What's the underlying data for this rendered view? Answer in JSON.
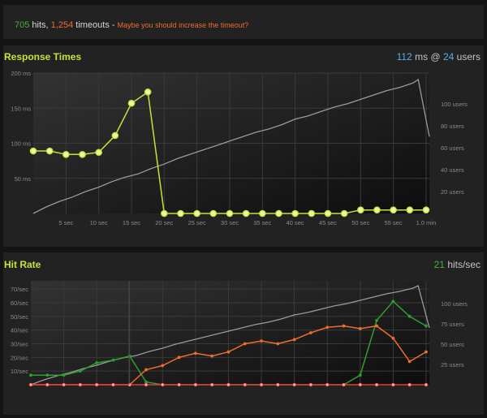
{
  "summary": {
    "hits": "705",
    "hits_label": "hits,",
    "timeouts": "1,254",
    "timeouts_label": "timeouts -",
    "message": "Maybe you should increase the timeout?"
  },
  "colors": {
    "response": "#c8e03a",
    "users": "#9a9a9a",
    "hits": "#2e9e2e",
    "failures": "#ee6d2c",
    "timeouts": "#e23a3a",
    "stat_blue": "#57aee8"
  },
  "chart_data": [
    {
      "type": "line",
      "title": "Response Times",
      "stat": {
        "value": "112",
        "unit": "ms",
        "at": "@",
        "users": "24",
        "users_unit": "users"
      },
      "x": {
        "ticks": [
          5,
          10,
          15,
          20,
          25,
          30,
          35,
          40,
          45,
          50,
          55,
          60
        ],
        "tick_labels": [
          "5 sec",
          "10 sec",
          "15 sec",
          "20 sec",
          "25 sec",
          "30 sec",
          "35 sec",
          "40 sec",
          "45 sec",
          "50 sec",
          "55 sec",
          "1.0 min"
        ],
        "range": [
          0,
          60.5
        ]
      },
      "y_left": {
        "ticks": [
          50,
          100,
          150,
          200
        ],
        "tick_labels": [
          "50 ms",
          "100 ms",
          "150 ms",
          "200 ms"
        ],
        "range": [
          0,
          200
        ]
      },
      "y_right": {
        "ticks": [
          20,
          40,
          60,
          80,
          100
        ],
        "tick_labels": [
          "20 users",
          "40 users",
          "60 users",
          "80 users",
          "100 users"
        ],
        "range": [
          0,
          128
        ]
      },
      "grid": true,
      "series": [
        {
          "role": "response",
          "axis": "left",
          "markers": true,
          "x": [
            0,
            2.5,
            5,
            7.5,
            10,
            12.5,
            15,
            17.5,
            20,
            22.5,
            25,
            27.5,
            30,
            32.5,
            35,
            37.5,
            40,
            42.5,
            45,
            47.5,
            50,
            52.5,
            55,
            57.5,
            60
          ],
          "y": [
            89,
            89,
            84,
            84,
            87,
            111,
            157,
            173,
            0,
            0,
            0,
            0,
            0,
            0,
            0,
            0,
            0,
            0,
            0,
            0,
            5,
            5,
            5,
            5,
            5
          ]
        },
        {
          "role": "users",
          "axis": "right",
          "markers": false,
          "x": [
            0,
            2,
            4,
            6,
            8,
            10,
            12,
            14,
            16,
            18,
            20,
            22,
            24,
            26,
            28,
            30,
            32,
            34,
            36,
            38,
            40,
            42,
            44,
            46,
            48,
            50,
            52,
            54,
            56,
            58,
            58.8,
            60.5
          ],
          "y": [
            0,
            6,
            11,
            15,
            20,
            24,
            29,
            33,
            36,
            41,
            45,
            50,
            54,
            58,
            62,
            66,
            70,
            74,
            77,
            81,
            86,
            89,
            93,
            97,
            100,
            104,
            108,
            112,
            115,
            119,
            122,
            70
          ]
        }
      ]
    },
    {
      "type": "line",
      "title": "Hit Rate",
      "stat": {
        "value": "21",
        "unit": "hits/sec"
      },
      "x": {
        "range": [
          0,
          60.5
        ]
      },
      "y_left": {
        "ticks": [
          10,
          20,
          30,
          40,
          50,
          60,
          70
        ],
        "tick_labels": [
          "10/sec",
          "20/sec",
          "30/sec",
          "40/sec",
          "50/sec",
          "60/sec",
          "70/sec"
        ],
        "range": [
          0,
          76
        ]
      },
      "y_right": {
        "ticks": [
          25,
          50,
          75,
          100
        ],
        "tick_labels": [
          "25 users",
          "50 users",
          "75 users",
          "100 users"
        ],
        "range": [
          0,
          128
        ]
      },
      "grid": true,
      "series": [
        {
          "role": "hits",
          "axis": "left",
          "markers": true,
          "x": [
            0,
            2.5,
            5,
            7.5,
            10,
            12.5,
            15,
            17.5,
            20,
            22.5,
            25,
            27.5,
            30,
            32.5,
            35,
            37.5,
            40,
            42.5,
            45,
            47.5,
            50,
            52.5,
            55,
            57.5,
            60
          ],
          "y": [
            7,
            7,
            7,
            10,
            16,
            18,
            21,
            2,
            0,
            0,
            0,
            0,
            0,
            0,
            0,
            0,
            0,
            0,
            0,
            0,
            7,
            47,
            61,
            50,
            43
          ]
        },
        {
          "role": "failures",
          "axis": "left",
          "markers": true,
          "x": [
            0,
            2.5,
            5,
            7.5,
            10,
            12.5,
            15,
            17.5,
            20,
            22.5,
            25,
            27.5,
            30,
            32.5,
            35,
            37.5,
            40,
            42.5,
            45,
            47.5,
            50,
            52.5,
            55,
            57.5,
            60
          ],
          "y": [
            0,
            0,
            0,
            0,
            0,
            0,
            0,
            11,
            14,
            20,
            23,
            21,
            24,
            30,
            32,
            30,
            33,
            38,
            42,
            43,
            41,
            43,
            34,
            17,
            24
          ]
        },
        {
          "role": "timeouts",
          "axis": "left",
          "markers": true,
          "x": [
            0,
            2.5,
            5,
            7.5,
            10,
            12.5,
            15,
            17.5,
            20,
            22.5,
            25,
            27.5,
            30,
            32.5,
            35,
            37.5,
            40,
            42.5,
            45,
            47.5,
            50,
            52.5,
            55,
            57.5,
            60
          ],
          "y": [
            0,
            0,
            0,
            0,
            0,
            0,
            0,
            0,
            0,
            0,
            0,
            0,
            0,
            0,
            0,
            0,
            0,
            0,
            0,
            0,
            0,
            0,
            0,
            0,
            0
          ]
        },
        {
          "role": "users",
          "axis": "right",
          "markers": false,
          "x": [
            0,
            2,
            4,
            6,
            8,
            10,
            12,
            14,
            16,
            18,
            20,
            22,
            24,
            26,
            28,
            30,
            32,
            34,
            36,
            38,
            40,
            42,
            44,
            46,
            48,
            50,
            52,
            54,
            56,
            58,
            58.8,
            60.5
          ],
          "y": [
            0,
            6,
            11,
            15,
            20,
            24,
            29,
            33,
            36,
            41,
            45,
            50,
            54,
            58,
            62,
            66,
            70,
            74,
            77,
            81,
            86,
            89,
            93,
            97,
            100,
            104,
            108,
            112,
            115,
            119,
            122,
            70
          ]
        }
      ]
    }
  ]
}
